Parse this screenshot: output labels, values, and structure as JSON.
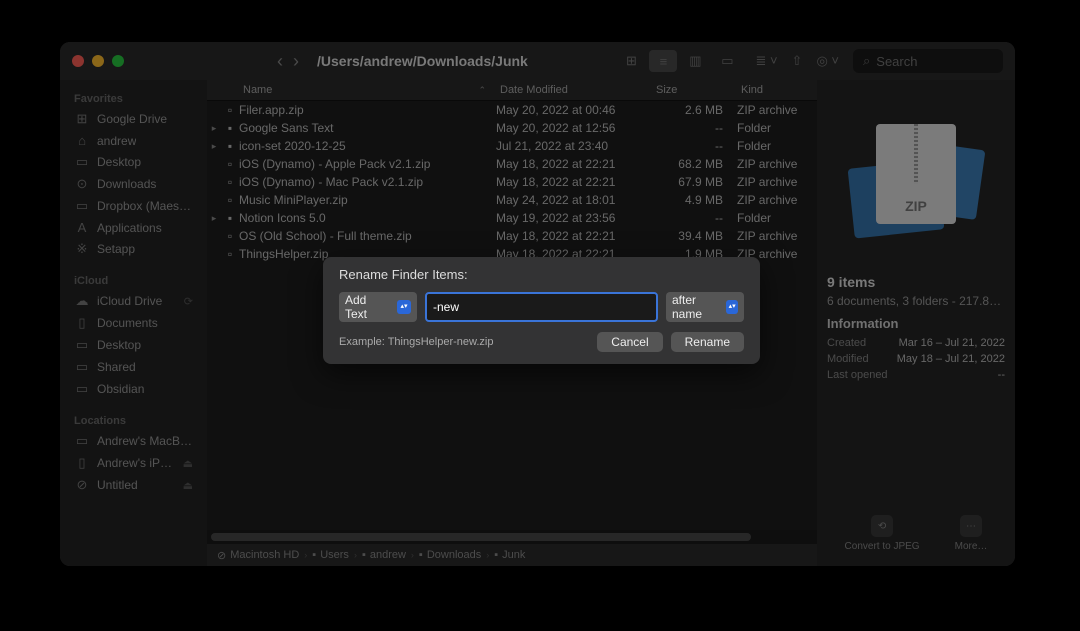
{
  "titlebar": {
    "path": "/Users/andrew/Downloads/Junk",
    "search_placeholder": "Search"
  },
  "sidebar": {
    "sections": [
      {
        "heading": "Favorites",
        "items": [
          {
            "icon": "⊞",
            "label": "Google Drive"
          },
          {
            "icon": "⌂",
            "label": "andrew"
          },
          {
            "icon": "▭",
            "label": "Desktop"
          },
          {
            "icon": "⊙",
            "label": "Downloads"
          },
          {
            "icon": "▭",
            "label": "Dropbox (Maes…"
          },
          {
            "icon": "A",
            "label": "Applications"
          },
          {
            "icon": "※",
            "label": "Setapp"
          }
        ]
      },
      {
        "heading": "iCloud",
        "items": [
          {
            "icon": "☁",
            "label": "iCloud Drive",
            "badge": "⟳"
          },
          {
            "icon": "▯",
            "label": "Documents"
          },
          {
            "icon": "▭",
            "label": "Desktop"
          },
          {
            "icon": "▭",
            "label": "Shared"
          },
          {
            "icon": "▭",
            "label": "Obsidian"
          }
        ]
      },
      {
        "heading": "Locations",
        "items": [
          {
            "icon": "▭",
            "label": "Andrew's MacB…"
          },
          {
            "icon": "▯",
            "label": "Andrew's iP…",
            "badge": "⏏"
          },
          {
            "icon": "⊘",
            "label": "Untitled",
            "badge": "⏏"
          }
        ]
      }
    ]
  },
  "columns": {
    "name": "Name",
    "date": "Date Modified",
    "size": "Size",
    "kind": "Kind"
  },
  "files": [
    {
      "d": "",
      "ic": "▫",
      "name": "Filer.app.zip",
      "date": "May 20, 2022 at 00:46",
      "size": "2.6 MB",
      "kind": "ZIP archive"
    },
    {
      "d": "▸",
      "ic": "▪",
      "name": "Google Sans Text",
      "date": "May 20, 2022 at 12:56",
      "size": "--",
      "kind": "Folder"
    },
    {
      "d": "▸",
      "ic": "▪",
      "name": "icon-set 2020-12-25",
      "date": "Jul 21, 2022 at 23:40",
      "size": "--",
      "kind": "Folder"
    },
    {
      "d": "",
      "ic": "▫",
      "name": "iOS (Dynamo) - Apple Pack v2.1.zip",
      "date": "May 18, 2022 at 22:21",
      "size": "68.2 MB",
      "kind": "ZIP archive"
    },
    {
      "d": "",
      "ic": "▫",
      "name": "iOS (Dynamo) - Mac Pack v2.1.zip",
      "date": "May 18, 2022 at 22:21",
      "size": "67.9 MB",
      "kind": "ZIP archive"
    },
    {
      "d": "",
      "ic": "▫",
      "name": "Music MiniPlayer.zip",
      "date": "May 24, 2022 at 18:01",
      "size": "4.9 MB",
      "kind": "ZIP archive"
    },
    {
      "d": "▸",
      "ic": "▪",
      "name": "Notion Icons 5.0",
      "date": "May 19, 2022 at 23:56",
      "size": "--",
      "kind": "Folder"
    },
    {
      "d": "",
      "ic": "▫",
      "name": "OS (Old School) - Full theme.zip",
      "date": "May 18, 2022 at 22:21",
      "size": "39.4 MB",
      "kind": "ZIP archive"
    },
    {
      "d": "",
      "ic": "▫",
      "name": "ThingsHelper.zip",
      "date": "May 18, 2022 at 22:21",
      "size": "1.9 MB",
      "kind": "ZIP archive"
    }
  ],
  "pathbar": [
    {
      "ic": "⊘",
      "label": "Macintosh HD"
    },
    {
      "ic": "▪",
      "label": "Users"
    },
    {
      "ic": "▪",
      "label": "andrew"
    },
    {
      "ic": "▪",
      "label": "Downloads"
    },
    {
      "ic": "▪",
      "label": "Junk"
    }
  ],
  "preview": {
    "zip_label": "ZIP",
    "title": "9 items",
    "subtitle": "6 documents, 3 folders - 217.8…",
    "info_heading": "Information",
    "rows": [
      {
        "k": "Created",
        "v": "Mar 16 – Jul 21, 2022"
      },
      {
        "k": "Modified",
        "v": "May 18 – Jul 21, 2022"
      },
      {
        "k": "Last opened",
        "v": "--"
      }
    ],
    "actions": [
      {
        "ic": "⟲",
        "label": "Convert to JPEG"
      },
      {
        "ic": "⋯",
        "label": "More…"
      }
    ]
  },
  "dialog": {
    "title": "Rename Finder Items:",
    "action_select": "Add Text",
    "text_value": "-new",
    "position_select": "after name",
    "example": "Example: ThingsHelper-new.zip",
    "cancel": "Cancel",
    "rename": "Rename"
  }
}
